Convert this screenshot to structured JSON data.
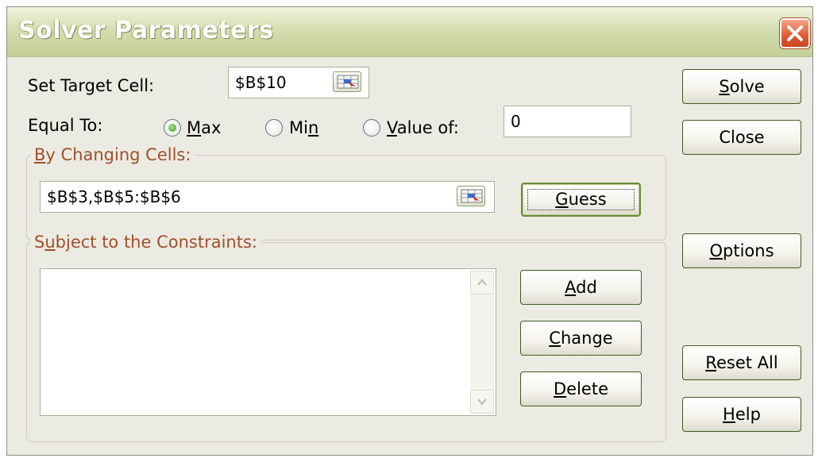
{
  "window": {
    "title": "Solver Parameters"
  },
  "target": {
    "label": "Set Target Cell:",
    "value": "$B$10"
  },
  "equal_to": {
    "label": "Equal To:",
    "options": [
      {
        "label": "Max",
        "mnemonic": "M",
        "rest": "ax",
        "selected": true
      },
      {
        "label": "Min",
        "prefix": "Mi",
        "mnemonic": "n",
        "selected": false
      },
      {
        "label": "Value of:",
        "mnemonic": "V",
        "rest": "alue of:",
        "selected": false
      }
    ],
    "value_of": "0"
  },
  "changing": {
    "label": "By Changing Cells:",
    "mnemonic": "B",
    "rest": "y Changing Cells:",
    "value": "$B$3,$B$5:$B$6"
  },
  "constraints": {
    "label": "Subject to the Constraints:",
    "prefix": "S",
    "mnemonic": "u",
    "rest": "bject to the Constraints:",
    "items": []
  },
  "buttons": {
    "solve": {
      "label": "Solve",
      "mnemonic": "S",
      "rest": "olve"
    },
    "close": {
      "label": "Close"
    },
    "guess": {
      "label": "Guess",
      "mnemonic": "G",
      "rest": "uess"
    },
    "options": {
      "label": "Options",
      "mnemonic": "O",
      "rest": "ptions"
    },
    "add": {
      "label": "Add",
      "mnemonic": "A",
      "rest": "dd"
    },
    "change": {
      "label": "Change",
      "mnemonic": "C",
      "rest": "hange"
    },
    "delete": {
      "label": "Delete",
      "mnemonic": "D",
      "rest": "elete"
    },
    "reset_all": {
      "label": "Reset All",
      "mnemonic": "R",
      "rest": "eset All"
    },
    "help": {
      "label": "Help",
      "mnemonic": "H",
      "rest": "elp"
    }
  },
  "icons": {
    "close": "close-x-icon",
    "range_picker": "collapse-dialog-icon",
    "scroll_up": "chevron-up-icon",
    "scroll_down": "chevron-down-icon"
  },
  "colors": {
    "dialog_bg": "#ecebe3",
    "titlebar": "#c3cf98",
    "group_title": "#a0502a",
    "close_button": "#e05a33"
  }
}
